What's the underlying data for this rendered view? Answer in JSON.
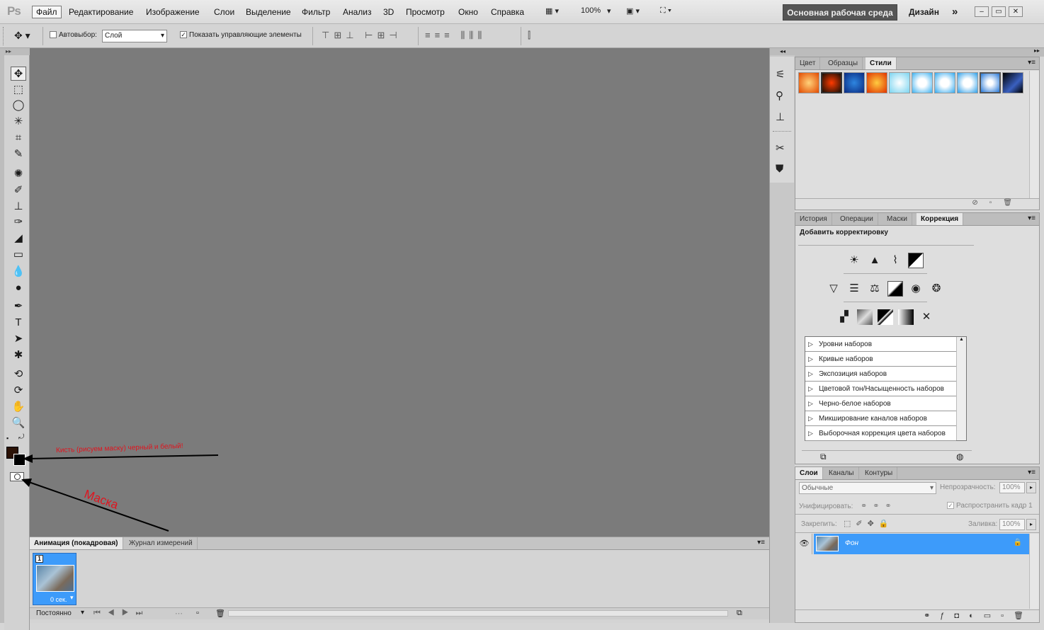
{
  "app": {
    "logo": "Ps"
  },
  "menu": [
    "Файл",
    "Редактирование",
    "Изображение",
    "Слои",
    "Выделение",
    "Фильтр",
    "Анализ",
    "3D",
    "Просмотр",
    "Окно",
    "Справка"
  ],
  "menubar_controls": {
    "zoom": "100%"
  },
  "workspace": {
    "current": "Основная рабочая среда",
    "design": "Дизайн",
    "more": "»"
  },
  "window_buttons": [
    "–",
    "▭",
    "✕"
  ],
  "options": {
    "autoselect_label": "Автовыбор:",
    "autoselect_value": "Слой",
    "show_controls_label": "Показать управляющие элементы",
    "show_controls_checked": true
  },
  "annotations": {
    "brush_note": "Кисть (рисуем маску) черный и белый!",
    "mask_note": "Маска"
  },
  "styles_panel": {
    "tabs": [
      "Цвет",
      "Образцы",
      "Стили"
    ],
    "active_tab": "Стили"
  },
  "adjust_panel": {
    "tabs": [
      "История",
      "Операции",
      "Маски",
      "Коррекция"
    ],
    "active_tab": "Коррекция",
    "title": "Добавить корректировку",
    "presets": [
      "Уровни наборов",
      "Кривые наборов",
      "Экспозиция наборов",
      "Цветовой тон/Насыщенность наборов",
      "Черно-белое наборов",
      "Микширование каналов наборов",
      "Выборочная коррекция цвета наборов"
    ]
  },
  "layers_panel": {
    "tabs": [
      "Слои",
      "Каналы",
      "Контуры"
    ],
    "active_tab": "Слои",
    "blend_mode": "Обычные",
    "opacity_label": "Непрозрачность:",
    "opacity_value": "100%",
    "unify_label": "Унифицировать:",
    "propagate_label": "Распространить кадр 1",
    "lock_label": "Закрепить:",
    "fill_label": "Заливка:",
    "fill_value": "100%",
    "layers": [
      {
        "name": "Фон",
        "selected": true,
        "visible": true,
        "locked": true
      }
    ]
  },
  "animation_panel": {
    "tabs": [
      "Анимация (покадровая)",
      "Журнал измерений"
    ],
    "active_tab": "Анимация (покадровая)",
    "frame_number": "1",
    "frame_delay": "0 сек.",
    "loop": "Постоянно"
  },
  "colors": {
    "foreground": "#2b1206",
    "background": "#000000",
    "selection": "#3d9bfa",
    "annotation": "#e0141e"
  }
}
